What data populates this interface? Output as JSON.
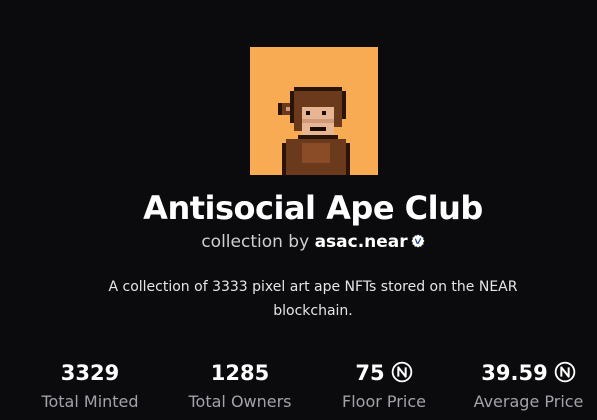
{
  "collection": {
    "title": "Antisocial Ape Club",
    "byline_prefix": "collection by",
    "owner": "asac.near",
    "description": "A collection of 3333 pixel art ape NFTs stored on the NEAR blockchain.",
    "avatar_background": "#f9ab53"
  },
  "stats": [
    {
      "value": "3329",
      "label": "Total Minted",
      "currency_icon": ""
    },
    {
      "value": "1285",
      "label": "Total Owners",
      "currency_icon": ""
    },
    {
      "value": "75",
      "label": "Floor Price",
      "currency_icon": "near-icon"
    },
    {
      "value": "39.59",
      "label": "Average Price",
      "currency_icon": "near-icon"
    }
  ],
  "colors": {
    "background": "#0b0b0d",
    "muted_text": "#a2a2aa",
    "verified_badge": "#ffffff"
  },
  "icons": {
    "verified": "verified-badge-icon",
    "currency": "near-icon"
  }
}
